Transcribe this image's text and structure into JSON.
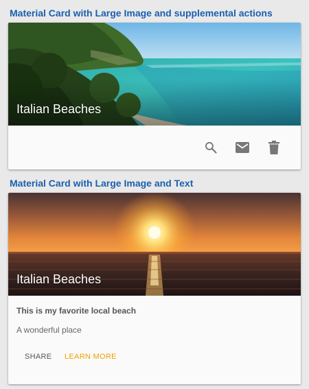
{
  "sections": [
    {
      "title": "Material Card with Large Image and supplemental actions",
      "card": {
        "media_title": "Italian Beaches",
        "actions": [
          {
            "icon": "search-icon"
          },
          {
            "icon": "mail-icon"
          },
          {
            "icon": "delete-icon"
          }
        ]
      }
    },
    {
      "title": "Material Card with Large Image and Text",
      "card": {
        "media_title": "Italian Beaches",
        "supporting_title": "This is my favorite local beach",
        "supporting_text": "A wonderful place",
        "actions": [
          {
            "label": "SHARE"
          },
          {
            "label": "LEARN MORE"
          }
        ]
      }
    }
  ],
  "colors": {
    "section_title": "#1b5fae",
    "accent": "#f0a000",
    "icon": "#777777",
    "background": "#e9e9e9",
    "card": "#fafafa"
  }
}
